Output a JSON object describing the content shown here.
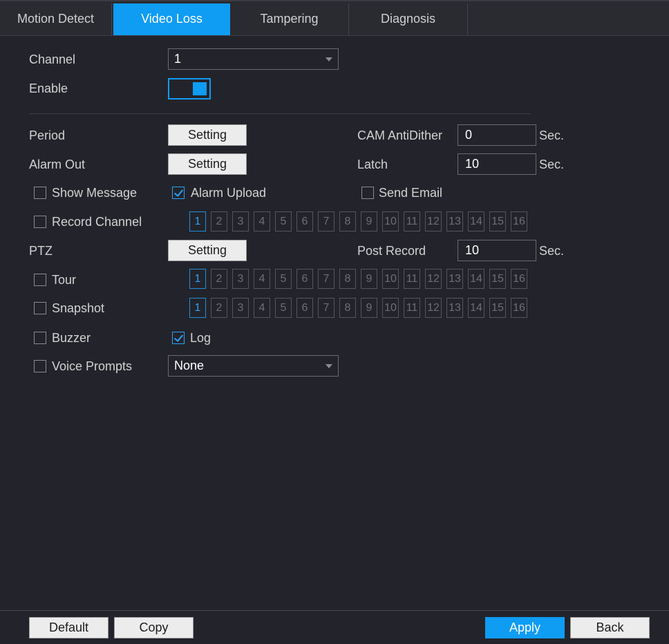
{
  "tabs": [
    {
      "label": "Motion Detect"
    },
    {
      "label": "Video Loss"
    },
    {
      "label": "Tampering"
    },
    {
      "label": "Diagnosis"
    }
  ],
  "active_tab": "Video Loss",
  "channel": {
    "label": "Channel",
    "value": "1"
  },
  "enable": {
    "label": "Enable",
    "state": "on"
  },
  "period": {
    "label": "Period",
    "button": "Setting"
  },
  "alarm_out": {
    "label": "Alarm Out",
    "button": "Setting"
  },
  "cam_antidither": {
    "label": "CAM AntiDither",
    "value": "0",
    "unit": "Sec."
  },
  "latch": {
    "label": "Latch",
    "value": "10",
    "unit": "Sec."
  },
  "show_message": {
    "label": "Show Message",
    "checked": false
  },
  "alarm_upload": {
    "label": "Alarm Upload",
    "checked": true
  },
  "send_email": {
    "label": "Send Email",
    "checked": false
  },
  "record_channel": {
    "label": "Record Channel",
    "checked": false
  },
  "ptz": {
    "label": "PTZ",
    "button": "Setting"
  },
  "post_record": {
    "label": "Post Record",
    "value": "10",
    "unit": "Sec."
  },
  "tour": {
    "label": "Tour",
    "checked": false
  },
  "snapshot": {
    "label": "Snapshot",
    "checked": false
  },
  "buzzer": {
    "label": "Buzzer",
    "checked": false
  },
  "log": {
    "label": "Log",
    "checked": true
  },
  "voice_prompts": {
    "label": "Voice Prompts",
    "checked": false,
    "value": "None"
  },
  "channel_numbers": [
    "1",
    "2",
    "3",
    "4",
    "5",
    "6",
    "7",
    "8",
    "9",
    "10",
    "11",
    "12",
    "13",
    "14",
    "15",
    "16"
  ],
  "selected_channel": "1",
  "footer": {
    "default": "Default",
    "copy": "Copy",
    "apply": "Apply",
    "back": "Back"
  },
  "colors": {
    "accent": "#0f9cf3",
    "background": "#23242b"
  }
}
